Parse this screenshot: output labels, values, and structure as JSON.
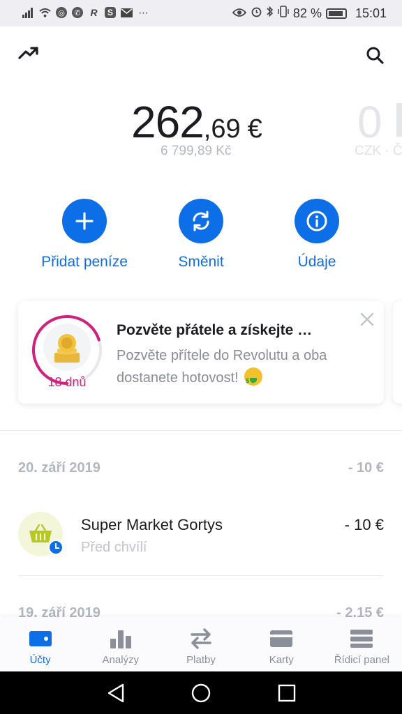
{
  "status_bar": {
    "left_icons": [
      "signal-icon",
      "wifi-icon",
      "chrome-icon",
      "whatsapp-icon",
      "r-app-icon",
      "s-app-icon",
      "mail-icon",
      "more-icon"
    ],
    "battery": "82 %",
    "time": "15:01"
  },
  "balance": {
    "integer": "262",
    "decimal": ",69",
    "currency": "€",
    "converted": "6 799,89 Kč",
    "next_account_value": "0",
    "next_account_sub": "CZK · Č"
  },
  "actions": [
    {
      "label": "Přidat peníze",
      "icon": "plus-icon"
    },
    {
      "label": "Směnit",
      "icon": "exchange-icon"
    },
    {
      "label": "Údaje",
      "icon": "info-icon"
    }
  ],
  "promo": {
    "title": "Pozvěte přátele a získejte …",
    "description": "Pozvěte přítele do Revolutu a oba dostanete hotovost!",
    "days_left": "18 dnů",
    "countdown_fraction": 0.7
  },
  "transactions": {
    "groups": [
      {
        "date": "20. září 2019",
        "total": "- 10 €"
      },
      {
        "date": "19. září 2019",
        "total": "- 2.15 €"
      }
    ],
    "items": [
      {
        "name": "Super Market Gortys",
        "time": "Před chvílí",
        "amount": "- 10 €"
      }
    ]
  },
  "bottom_nav": [
    {
      "label": "Účty",
      "icon": "wallet-icon",
      "active": true
    },
    {
      "label": "Analýzy",
      "icon": "bar-chart-icon",
      "active": false
    },
    {
      "label": "Platby",
      "icon": "transfer-arrows-icon",
      "active": false
    },
    {
      "label": "Karty",
      "icon": "card-icon",
      "active": false
    },
    {
      "label": "Řídicí panel",
      "icon": "dashboard-icon",
      "active": false
    }
  ],
  "colors": {
    "accent": "#0d6fe8",
    "promo_ring": "#d31f7e"
  }
}
